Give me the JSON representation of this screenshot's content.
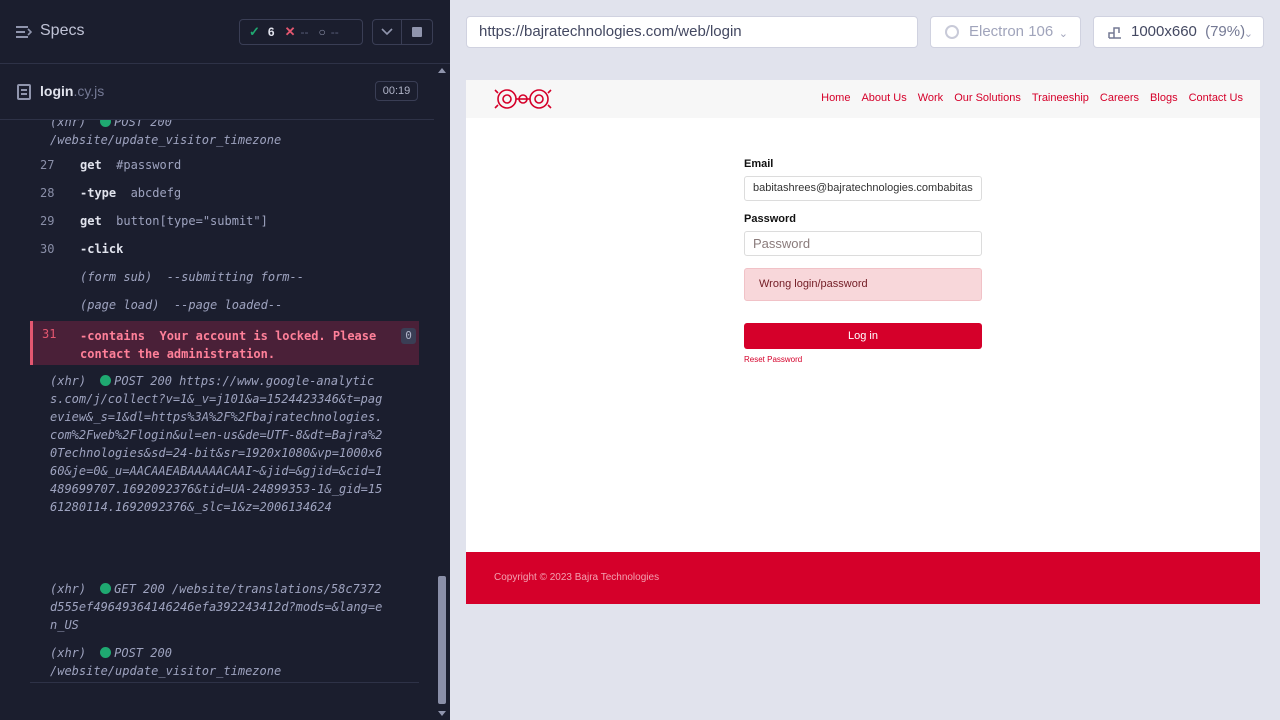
{
  "runner": {
    "specs_label": "Specs",
    "passed_count": "6",
    "pass_icon": "✓",
    "fail_icon": "✕",
    "pending_icon": "○",
    "dash": "--",
    "file_base": "login",
    "file_ext": ".cy.js",
    "duration": "00:19"
  },
  "log": {
    "top_xhr_line1_tag": "(xhr)",
    "top_xhr_line1_text": "POST 200",
    "top_xhr_line2": "/website/update_visitor_timezone",
    "steps": [
      {
        "num": "27",
        "cmd": "get",
        "arg": "#password"
      },
      {
        "num": "28",
        "cmd": "-type",
        "arg": "abcdefg"
      },
      {
        "num": "29",
        "cmd": "get",
        "arg": "button[type=\"submit\"]"
      },
      {
        "num": "30",
        "cmd": "-click",
        "arg": ""
      }
    ],
    "form_sub": "(form sub)",
    "form_sub_msg": "--submitting form--",
    "page_load": "(page load)",
    "page_load_msg": "--page loaded--",
    "error": {
      "num": "31",
      "cmd": "-contains",
      "msg": "Your account is locked. Please contact the administration.",
      "badge": "0"
    },
    "xhr1_tag": "(xhr)",
    "xhr1_text": "POST 200 https://www.google-analytics.com/j/collect?v=1&_v=j101&a=1524423346&t=pageview&_s=1&dl=https%3A%2F%2Fbajratechnologies.com%2Fweb%2Flogin&ul=en-us&de=UTF-8&dt=Bajra%20Technologies&sd=24-bit&sr=1920x1080&vp=1000x660&je=0&_u=AACAAEABAAAAACAAI~&jid=&gjid=&cid=1489699707.1692092376&tid=UA-24899353-1&_gid=1561280114.1692092376&_slc=1&z=2006134624",
    "xhr2_tag": "(xhr)",
    "xhr2_text": "GET 200 /website/translations/58c7372d555ef49649364146246efa392243412d?mods=&lang=en_US",
    "xhr3_tag": "(xhr)",
    "xhr3_text": "POST 200",
    "xhr3_line2": "/website/update_visitor_timezone"
  },
  "preview": {
    "url": "https://bajratechnologies.com/web/login",
    "browser": "Electron 106",
    "viewport": "1000x660",
    "zoom": "(79%)"
  },
  "site": {
    "nav": [
      "Home",
      "About Us",
      "Work",
      "Our Solutions",
      "Traineeship",
      "Careers",
      "Blogs",
      "Contact Us"
    ],
    "email_label": "Email",
    "email_value": "babitashrees@bajratechnologies.combabitas",
    "password_label": "Password",
    "password_placeholder": "Password",
    "alert": "Wrong login/password",
    "login_button": "Log in",
    "reset_link": "Reset Password",
    "copyright": "Copyright © 2023 Bajra Technologies",
    "brand_color": "#d5002a"
  }
}
